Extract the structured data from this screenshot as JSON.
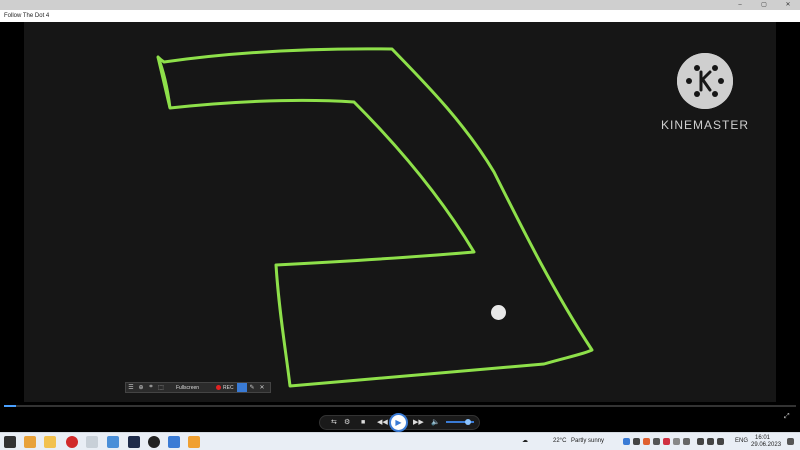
{
  "window": {
    "title": "Follow The Dot 4"
  },
  "window_controls": [
    "–",
    "▢",
    "✕"
  ],
  "video": {
    "path_color": "#8ee04a",
    "dot_color": "#e8e8e8",
    "watermark": "KINEMASTER",
    "watermark_logo_letter": "K"
  },
  "recorder": {
    "icons": [
      "menu-icon",
      "target-icon",
      "crop-icon",
      "region-icon"
    ],
    "mode_label": "Fullscreen",
    "rec_label": "REC",
    "rec_color": "#e22222"
  },
  "player": {
    "progress_fraction": 0.015,
    "volume_fraction": 0.8,
    "buttons": [
      "repeat-icon",
      "settings-icon",
      "stop-icon",
      "rewind-icon",
      "play-icon",
      "forward-icon",
      "volume-icon"
    ]
  },
  "taskbar": {
    "weather_temp": "22°C",
    "weather_text": "Partly sunny",
    "language": "ENG",
    "time": "16:01",
    "date": "29.06.2023"
  }
}
